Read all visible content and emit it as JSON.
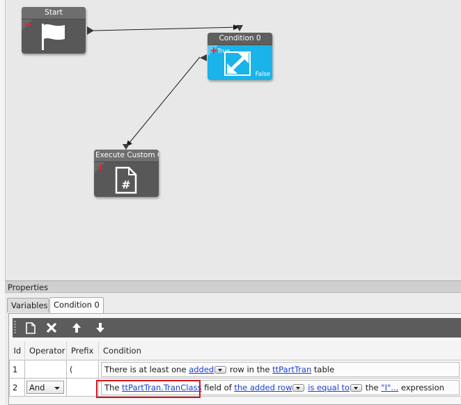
{
  "workflow": {
    "nodes": [
      {
        "id": "start",
        "title": "Start",
        "icon": "flag-icon"
      },
      {
        "id": "condition",
        "title": "Condition 0",
        "icon": "expand-arrows-icon",
        "true_label": "True",
        "false_label": "False"
      },
      {
        "id": "custom",
        "title": "Execute Custom Co",
        "icon": "code-file-icon"
      }
    ]
  },
  "properties": {
    "header": "Properties",
    "tabs": [
      {
        "label": "Variables",
        "active": false
      },
      {
        "label": "Condition 0",
        "active": true
      }
    ],
    "toolbar": [
      {
        "name": "new-icon"
      },
      {
        "name": "delete-icon"
      },
      {
        "name": "move-up-icon"
      },
      {
        "name": "move-down-icon"
      }
    ],
    "columns": [
      "Id",
      "Operator",
      "Prefix",
      "Condition"
    ],
    "rows": [
      {
        "id": "1",
        "operator": "",
        "prefix": "(",
        "parts": {
          "t1": "There is at least one ",
          "l1": "added",
          "t2": " row in the ",
          "l2": "ttPartTran",
          "t3": " table"
        }
      },
      {
        "id": "2",
        "operator": "And",
        "prefix": "",
        "parts": {
          "t1": "The ",
          "l1": "ttPartTran.TranClass",
          "t2": " field of ",
          "l2": "the added row",
          "t3": " ",
          "l3": "is equal to",
          "t4": " the ",
          "l4": "\"I\"...",
          "t5": " expression"
        }
      }
    ]
  },
  "colors": {
    "canvas": "#e8e8e8",
    "node": "#585858",
    "condition_node": "#1ab3ea",
    "highlight": "#d9121b",
    "link": "#1b3fd8"
  }
}
